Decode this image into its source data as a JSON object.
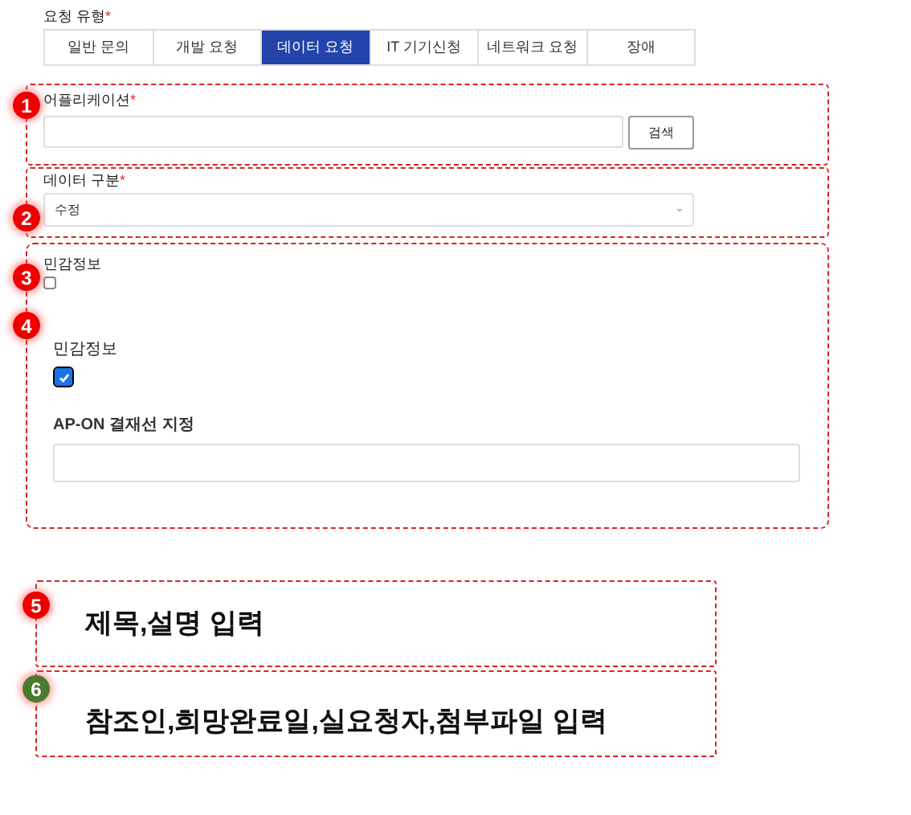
{
  "request_type": {
    "label": "요청 유형",
    "required_mark": "*",
    "tabs": [
      {
        "label": "일반 문의",
        "selected": false
      },
      {
        "label": "개발 요청",
        "selected": false
      },
      {
        "label": "데이터 요청",
        "selected": true
      },
      {
        "label": "IT 기기신청",
        "selected": false
      },
      {
        "label": "네트워크 요청",
        "selected": false
      },
      {
        "label": "장애",
        "selected": false
      }
    ]
  },
  "application": {
    "badge": {
      "number": "1",
      "color": "#ee0000"
    },
    "label": "어플리케이션",
    "required_mark": "*",
    "button": "검색"
  },
  "data_type": {
    "badge": {
      "number": "2",
      "color": "#ee0000"
    },
    "label": "데이터 구분",
    "required_mark": "*",
    "value": "수정"
  },
  "sensitive": {
    "badge": {
      "number": "3",
      "color": "#ee0000"
    },
    "label": "민감정보",
    "checked": false
  },
  "sensitive_new": {
    "badge": {
      "number": "4",
      "color": "#ee0000"
    },
    "label": "민감정보",
    "checked": true,
    "approval_label": "AP-ON 결재선 지정"
  },
  "notes": [
    {
      "badge": {
        "number": "5",
        "color": "#ee0000"
      },
      "text": "제목,설명 입력"
    },
    {
      "badge": {
        "number": "6",
        "color": "#4a7a2e"
      },
      "text": "참조인,희망완료일,실요청자,첨부파일 입력"
    }
  ]
}
